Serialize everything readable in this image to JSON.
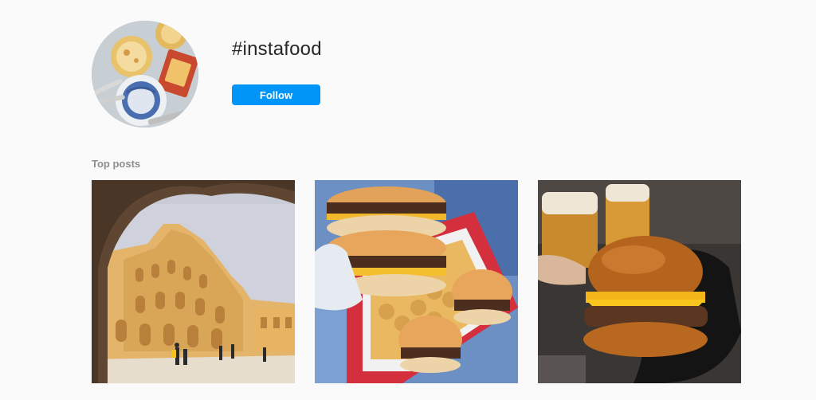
{
  "header": {
    "hashtag": "#instafood",
    "follow_label": "Follow"
  },
  "section": {
    "title": "Top posts"
  },
  "colors": {
    "follow_button": "#0095f6",
    "background": "#fafafa",
    "muted_text": "#8e8e8e"
  },
  "posts": [
    {
      "subject": "palace-courtyard-photo"
    },
    {
      "subject": "stacked-burgers-photo"
    },
    {
      "subject": "burger-and-beer-photo"
    }
  ]
}
